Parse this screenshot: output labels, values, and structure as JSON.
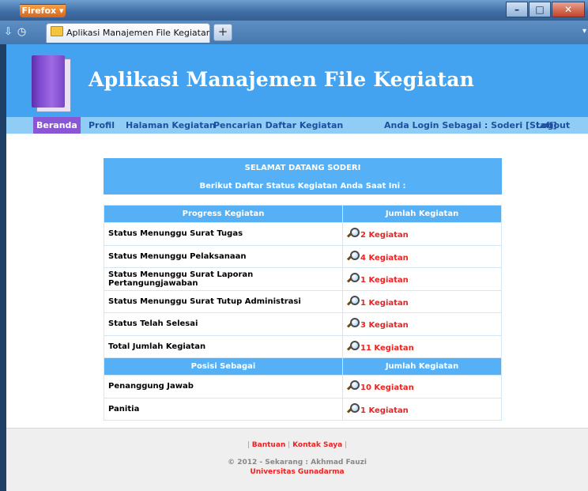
{
  "browser": {
    "menu_button": "Firefox ▾",
    "tab_title": "Aplikasi Manajemen File Kegiatan",
    "new_tab": "+"
  },
  "header": {
    "title": "Aplikasi Manajemen File Kegiatan"
  },
  "menu": {
    "items": [
      "Beranda",
      "Profil",
      "Halaman Kegiatan",
      "Pencarian Daftar Kegiatan"
    ],
    "login_info": "Anda Login Sebagai : Soderi [Staff]",
    "logout": "Logout"
  },
  "welcome": {
    "line1": "SELAMAT DATANG SODERI",
    "line2": "Berikut Daftar Status Kegiatan Anda Saat Ini :"
  },
  "table": {
    "progress_header": [
      "Progress Kegiatan",
      "Jumlah Kegiatan"
    ],
    "progress_rows": [
      {
        "label": "Status Menunggu Surat Tugas",
        "count": "2 Kegiatan"
      },
      {
        "label": "Status Menunggu Pelaksanaan",
        "count": "4 Kegiatan"
      },
      {
        "label": "Status Menunggu Surat Laporan Pertangungjawaban",
        "count": "1 Kegiatan"
      },
      {
        "label": "Status Menunggu Surat Tutup Administrasi",
        "count": "1 Kegiatan"
      },
      {
        "label": "Status Telah Selesai",
        "count": "3 Kegiatan"
      },
      {
        "label": "Total Jumlah Kegiatan",
        "count": "11 Kegiatan"
      }
    ],
    "position_header": [
      "Posisi Sebagai",
      "Jumlah Kegiatan"
    ],
    "position_rows": [
      {
        "label": "Penanggung Jawab",
        "count": "10 Kegiatan"
      },
      {
        "label": "Panitia",
        "count": "1 Kegiatan"
      }
    ]
  },
  "footer": {
    "links": [
      "Bantuan",
      "Kontak Saya"
    ],
    "copyright": "© 2012 - Sekarang : Akhmad Fauzi",
    "university": "Universitas Gunadarma"
  },
  "colors": {
    "header_bg": "#43a3f0",
    "menu_bg": "#8fcdf6",
    "active_menu": "#8a56d6",
    "table_header": "#55b0f5",
    "count_text": "#ee2222"
  }
}
